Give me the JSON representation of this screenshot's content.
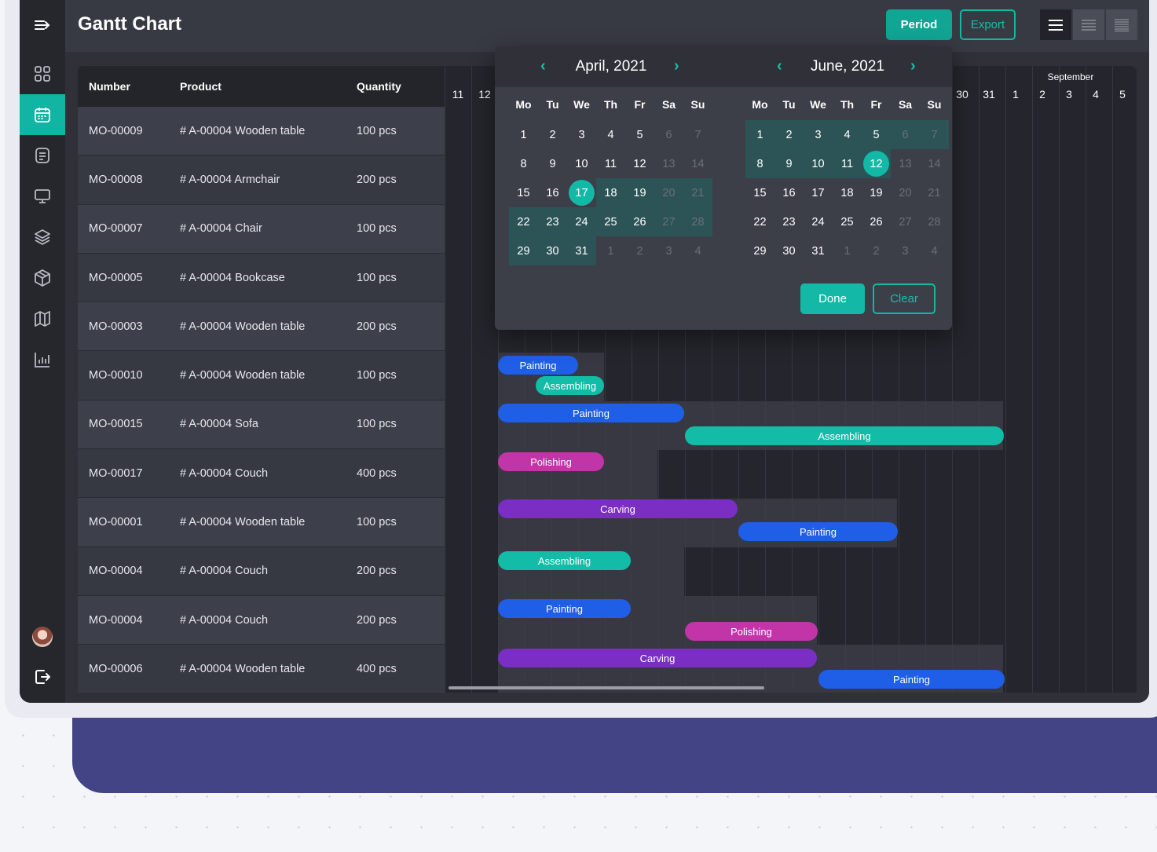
{
  "app": {
    "title": "Gantt Chart"
  },
  "toolbar": {
    "period_label": "Period",
    "export_label": "Export"
  },
  "sidebar": {
    "items": [
      {
        "icon": "menu-expand-icon"
      },
      {
        "icon": "dashboard-icon"
      },
      {
        "icon": "calendar-icon",
        "active": true
      },
      {
        "icon": "document-icon"
      },
      {
        "icon": "monitor-icon"
      },
      {
        "icon": "layers-icon"
      },
      {
        "icon": "cube-icon"
      },
      {
        "icon": "map-icon"
      },
      {
        "icon": "bar-chart-icon"
      }
    ],
    "bottom": [
      {
        "icon": "avatar"
      },
      {
        "icon": "logout-icon"
      }
    ]
  },
  "table": {
    "headers": [
      "Number",
      "Product",
      "Quantity"
    ],
    "rows": [
      {
        "number": "MO-00009",
        "product": "# A-00004 Wooden table",
        "qty": "100 pcs"
      },
      {
        "number": "MO-00008",
        "product": "# A-00004 Armchair",
        "qty": "200 pcs"
      },
      {
        "number": "MO-00007",
        "product": "# A-00004 Chair",
        "qty": "100 pcs"
      },
      {
        "number": "MO-00005",
        "product": "# A-00004 Bookcase",
        "qty": "100 pcs"
      },
      {
        "number": "MO-00003",
        "product": "# A-00004 Wooden table",
        "qty": "200 pcs"
      },
      {
        "number": "MO-00010",
        "product": "# A-00004 Wooden table",
        "qty": "100 pcs"
      },
      {
        "number": "MO-00015",
        "product": "# A-00004 Sofa",
        "qty": "100 pcs"
      },
      {
        "number": "MO-00017",
        "product": "# A-00004 Couch",
        "qty": "400 pcs"
      },
      {
        "number": "MO-00001",
        "product": "# A-00004 Wooden table",
        "qty": "100 pcs"
      },
      {
        "number": "MO-00004",
        "product": "# A-00004 Couch",
        "qty": "200 pcs"
      },
      {
        "number": "MO-00004",
        "product": "# A-00004 Couch",
        "qty": "200 pcs"
      },
      {
        "number": "MO-00006",
        "product": "# A-00004 Wooden table",
        "qty": "400 pcs"
      }
    ]
  },
  "timeline": {
    "month_label": "September",
    "visible_days": [
      "11",
      "12",
      "30",
      "31",
      "1",
      "2",
      "3",
      "4",
      "5"
    ]
  },
  "tasks": [
    {
      "label": "Painting",
      "color": "#1f5ee6"
    },
    {
      "label": "Assembling",
      "color": "#12bca6"
    },
    {
      "label": "Painting",
      "color": "#1f5ee6"
    },
    {
      "label": "Assembling",
      "color": "#12bca6"
    },
    {
      "label": "Polishing",
      "color": "#c235a8"
    },
    {
      "label": "Carving",
      "color": "#7a2ec4"
    },
    {
      "label": "Painting",
      "color": "#1f5ee6"
    },
    {
      "label": "Assembling",
      "color": "#12bca6"
    },
    {
      "label": "Painting",
      "color": "#1f5ee6"
    },
    {
      "label": "Polishing",
      "color": "#c235a8"
    },
    {
      "label": "Carving",
      "color": "#7a2ec4"
    },
    {
      "label": "Painting",
      "color": "#1f5ee6"
    }
  ],
  "datepicker": {
    "weekdays": [
      "Mo",
      "Tu",
      "We",
      "Th",
      "Fr",
      "Sa",
      "Su"
    ],
    "calendars": [
      {
        "title": "April, 2021",
        "weeks": [
          [
            "1",
            "2",
            "3",
            "4",
            "5",
            "6",
            "7"
          ],
          [
            "8",
            "9",
            "10",
            "11",
            "12",
            "13",
            "14"
          ],
          [
            "15",
            "16",
            "17",
            "18",
            "19",
            "20",
            "21"
          ],
          [
            "22",
            "23",
            "24",
            "25",
            "26",
            "27",
            "28"
          ],
          [
            "29",
            "30",
            "31",
            "1",
            "2",
            "3",
            "4"
          ]
        ],
        "selected": "17"
      },
      {
        "title": "June, 2021",
        "weeks": [
          [
            "1",
            "2",
            "3",
            "4",
            "5",
            "6",
            "7"
          ],
          [
            "8",
            "9",
            "10",
            "11",
            "12",
            "13",
            "14"
          ],
          [
            "15",
            "16",
            "17",
            "18",
            "19",
            "20",
            "21"
          ],
          [
            "22",
            "23",
            "24",
            "25",
            "26",
            "27",
            "28"
          ],
          [
            "29",
            "30",
            "31",
            "1",
            "2",
            "3",
            "4"
          ]
        ],
        "selected": "12"
      }
    ],
    "done_label": "Done",
    "clear_label": "Clear"
  },
  "colors": {
    "accent": "#13b9a6",
    "painting": "#1f5ee6",
    "assembling": "#12bca6",
    "polishing": "#c235a8",
    "carving": "#7a2ec4"
  }
}
